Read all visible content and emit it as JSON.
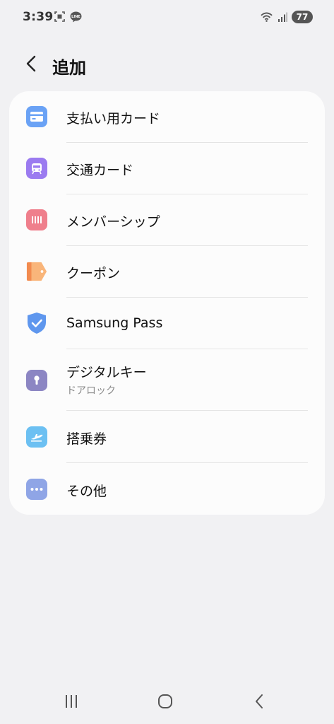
{
  "status": {
    "time": "3:39",
    "battery": "77",
    "icons": [
      "screenshot-icon",
      "line-icon",
      "wifi-icon",
      "signal-icon"
    ]
  },
  "header": {
    "title": "追加",
    "back_icon": "back-arrow-icon"
  },
  "items": [
    {
      "label": "支払い用カード",
      "icon": "credit-card-icon",
      "color": "#6aa2f5"
    },
    {
      "label": "交通カード",
      "icon": "transit-icon",
      "color": "#9b7bf0"
    },
    {
      "label": "メンバーシップ",
      "icon": "membership-icon",
      "color": "#ef7f8c"
    },
    {
      "label": "クーポン",
      "icon": "coupon-icon",
      "color": "#f7a46b"
    },
    {
      "label": "Samsung Pass",
      "icon": "shield-check-icon",
      "color": "#5f97ee"
    },
    {
      "label": "デジタルキー",
      "sub": "ドアロック",
      "icon": "key-icon",
      "color": "#8c86c3"
    },
    {
      "label": "搭乗券",
      "icon": "boarding-pass-icon",
      "color": "#6cc0f2"
    },
    {
      "label": "その他",
      "icon": "more-icon",
      "color": "#8fa5e6"
    }
  ],
  "nav": {
    "recents": "recents-icon",
    "home": "home-icon",
    "back": "back-icon"
  }
}
